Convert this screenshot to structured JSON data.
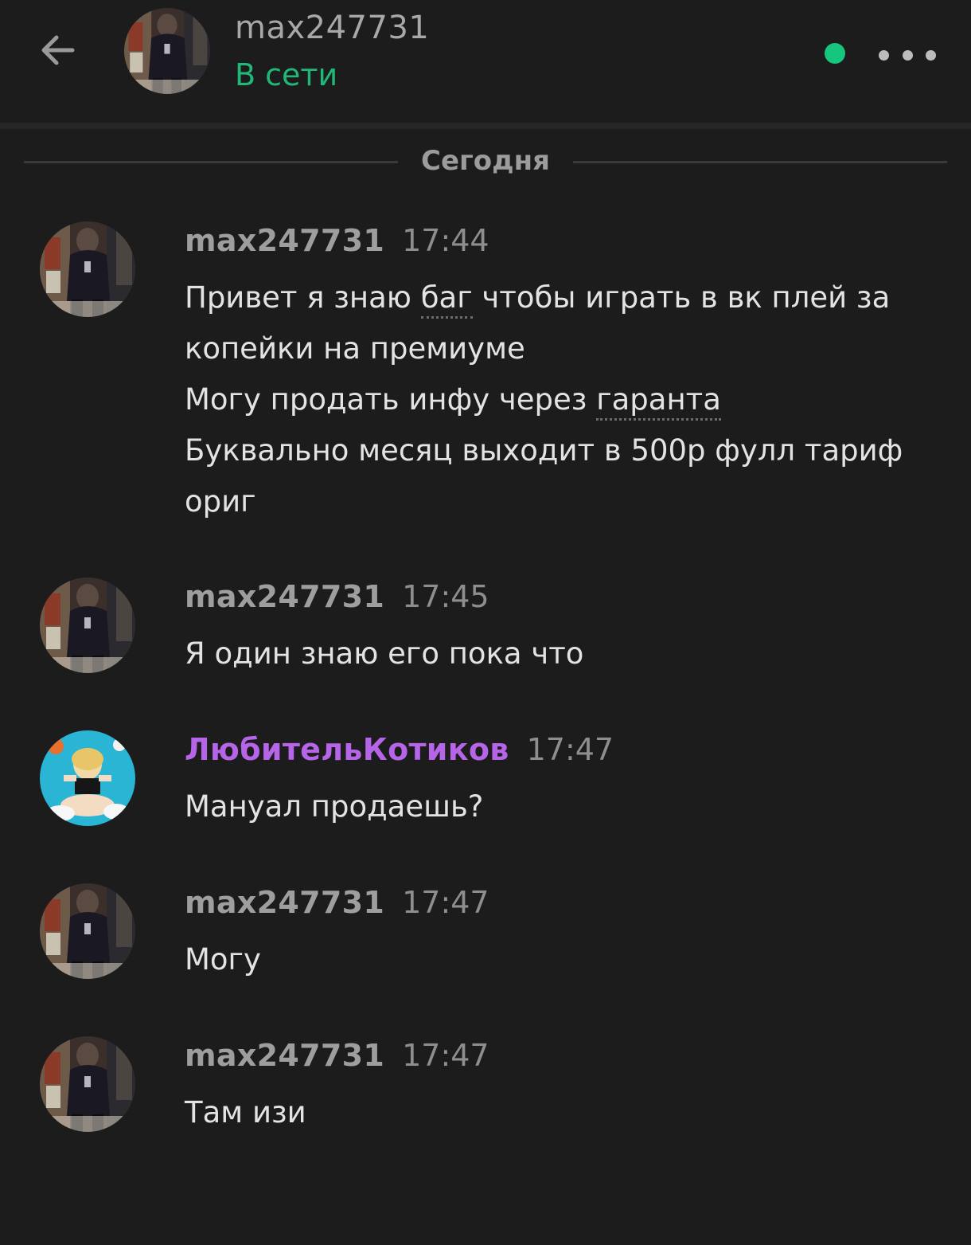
{
  "header": {
    "username": "max247731",
    "status": "В сети",
    "status_color": "#1fb877",
    "online_dot_color": "#17c67e",
    "back_icon": "arrow-left-icon",
    "more_icon": "more-horizontal-icon"
  },
  "date_separator": "Сегодня",
  "messages": [
    {
      "author": "max247731",
      "time": "17:44",
      "lines": [
        [
          "Привет я знаю ",
          "баг",
          " чтобы играть в вк плей за"
        ],
        [
          "копейки на премиуме"
        ],
        [
          "Могу продать инфу через ",
          "гаранта",
          ""
        ],
        [
          "Буквально месяц выходит в 500р фулл тариф"
        ],
        [
          "ориг"
        ]
      ]
    },
    {
      "author": "max247731",
      "time": "17:45",
      "text": "Я один знаю его пока что"
    },
    {
      "author": "ЛюбительКотиков",
      "time": "17:47",
      "text": "Мануал продаешь?",
      "author_color": "#b664e8"
    },
    {
      "author": "max247731",
      "time": "17:47",
      "text": "Могу"
    },
    {
      "author": "max247731",
      "time": "17:47",
      "text": "Там изи"
    }
  ]
}
